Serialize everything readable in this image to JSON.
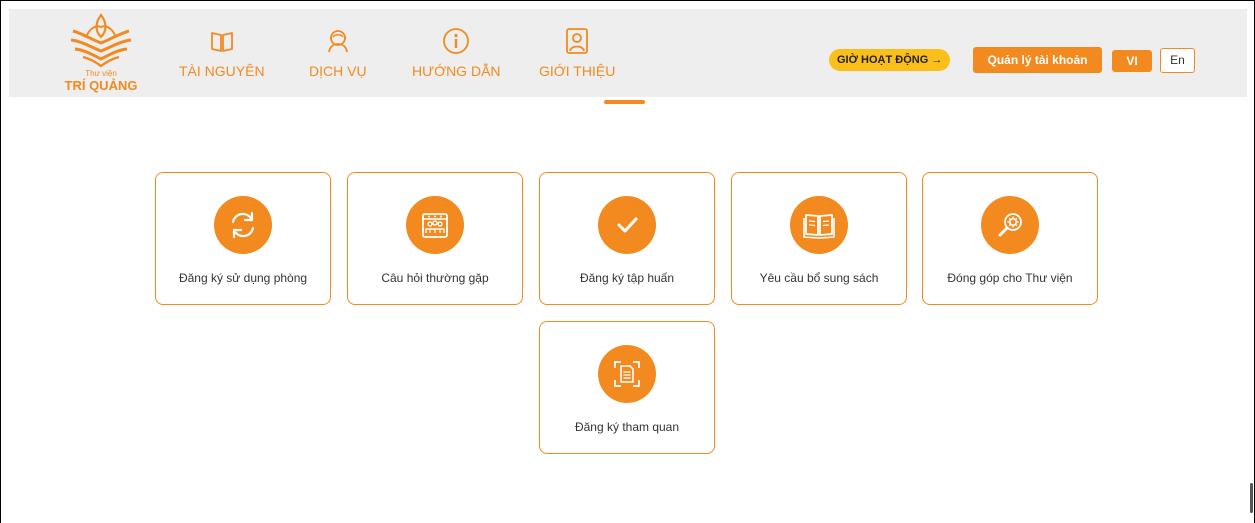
{
  "header": {
    "logo": {
      "subtitle": "Thư viện",
      "title": "TRÍ QUẢNG",
      "icon": "lotus-book-logo"
    },
    "nav": [
      {
        "label": "TÀI NGUYÊN",
        "icon": "book-icon"
      },
      {
        "label": "DỊCH VỤ",
        "icon": "service-person-icon"
      },
      {
        "label": "HƯỚNG DẪN",
        "icon": "info-icon"
      },
      {
        "label": "GIỚI THIỆU",
        "icon": "profile-card-icon"
      }
    ],
    "hours_button": "GIỜ HOẠT ĐỘNG →",
    "account_button": "Quản lý tài khoản",
    "lang_vi": "VI",
    "lang_en": "En"
  },
  "services": [
    {
      "label": "Đăng ký sử dụng phòng",
      "icon": "refresh-icon"
    },
    {
      "label": "Câu hỏi thường gặp",
      "icon": "group-calendar-icon"
    },
    {
      "label": "Đăng ký tập huấn",
      "icon": "checkmark-icon"
    },
    {
      "label": "Yêu cầu bổ sung sách",
      "icon": "open-book-icon"
    },
    {
      "label": "Đóng góp cho Thư viện",
      "icon": "magnifier-gear-icon"
    },
    {
      "label": "Đăng ký tham quan",
      "icon": "document-scan-icon"
    }
  ],
  "colors": {
    "accent": "#f28a1f",
    "hours": "#fbbf1a",
    "header_bg": "#eeeeee"
  }
}
